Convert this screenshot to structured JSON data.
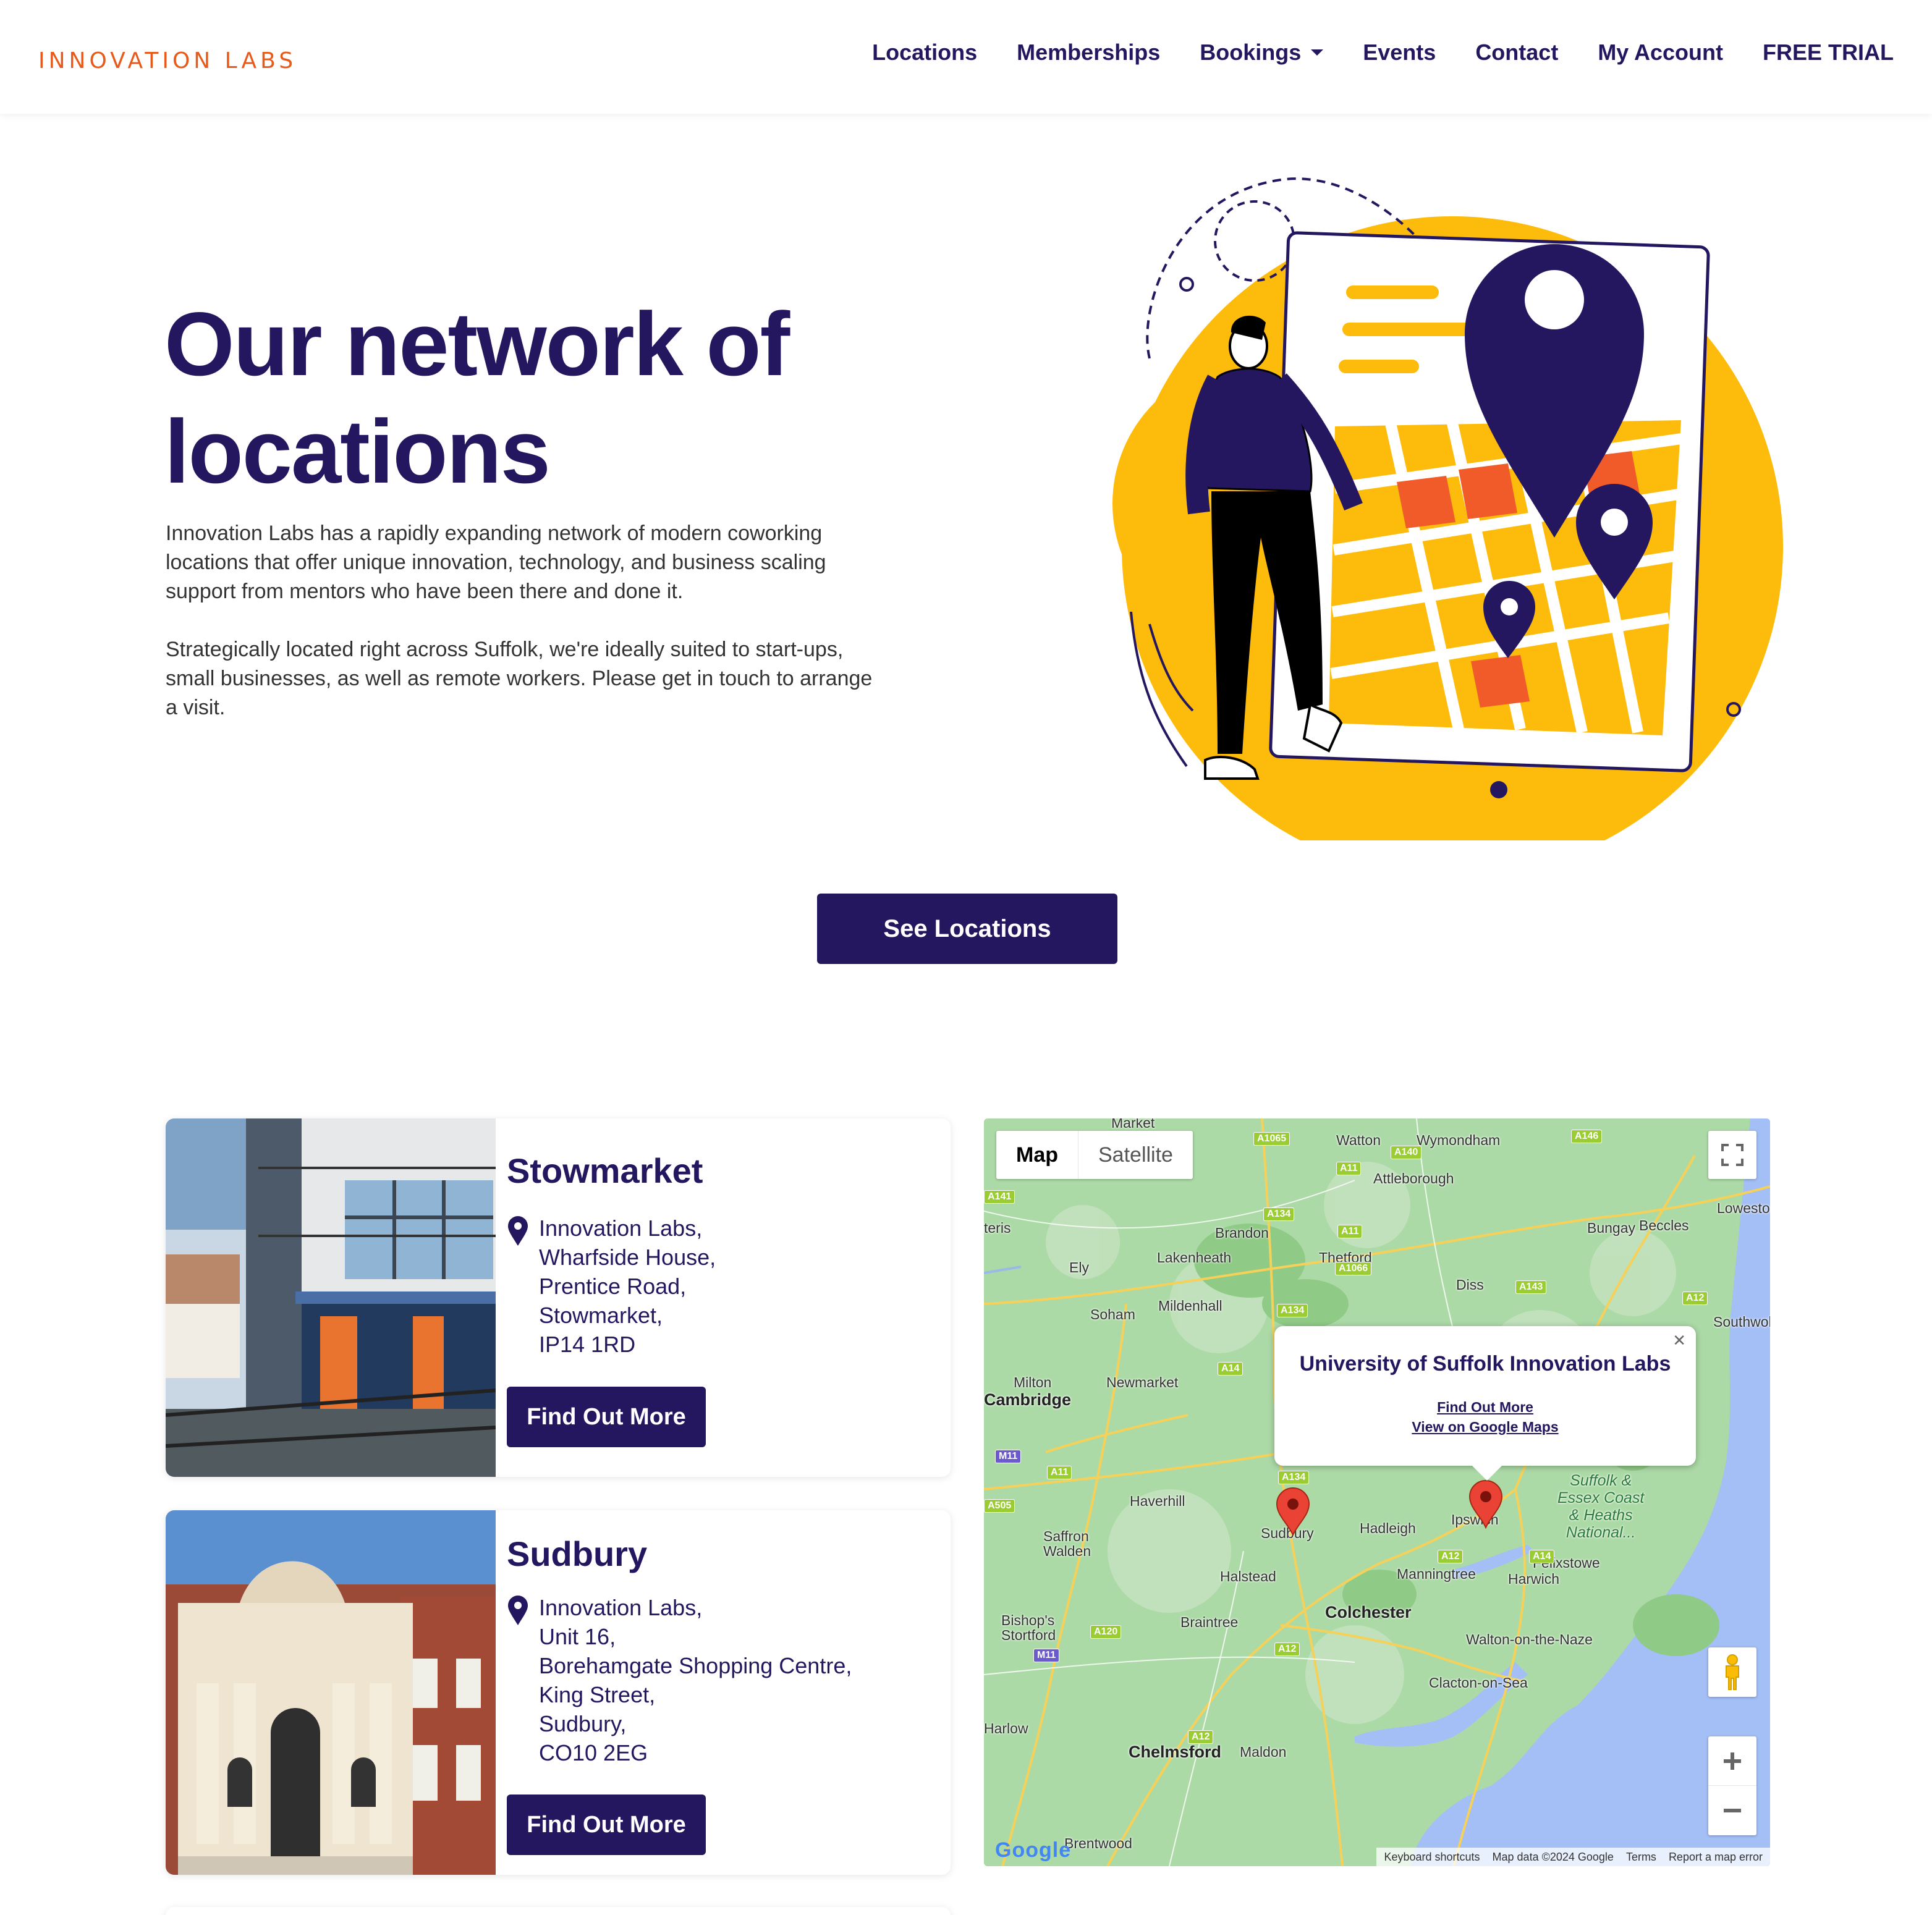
{
  "header": {
    "logo": "INNOVATION LABS",
    "nav": [
      "Locations",
      "Memberships",
      "Bookings",
      "Events",
      "Contact",
      "My Account",
      "FREE TRIAL"
    ]
  },
  "hero": {
    "title_line1": "Our network of",
    "title_line2": "locations",
    "para1": "Innovation Labs has a rapidly expanding network of modern coworking locations that offer unique innovation, technology, and business scaling support from mentors who have been there and done it.",
    "para2": "Strategically located right across Suffolk, we're ideally suited to start-ups, small businesses, as well as remote workers. Please get in touch to arrange a visit.",
    "button": "See Locations"
  },
  "locations": [
    {
      "name": "Stowmarket",
      "address": [
        "Innovation Labs,",
        "Wharfside House,",
        "Prentice Road,",
        "Stowmarket,",
        "IP14 1RD"
      ],
      "button": "Find Out More"
    },
    {
      "name": "Sudbury",
      "address": [
        "Innovation Labs,",
        "Unit 16,",
        "Borehamgate Shopping Centre,",
        "King Street,",
        "Sudbury,",
        "CO10 2EG"
      ],
      "button": "Find Out More"
    }
  ],
  "map": {
    "type_map": "Map",
    "type_satellite": "Satellite",
    "infowindow": {
      "title": "University of Suffolk Innovation Labs",
      "link1": "Find Out More",
      "link2": "View on Google Maps"
    },
    "places": {
      "market": "Market",
      "watton": "Watton",
      "wymondham": "Wymondham",
      "attleborough": "Attleborough",
      "brandon": "Brandon",
      "thetford": "Thetford",
      "bungay": "Bungay",
      "beccles": "Beccles",
      "lowestoft": "Lowesto",
      "ely": "Ely",
      "lakenheath": "Lakenheath",
      "mildenhall": "Mildenhall",
      "diss": "Diss",
      "soham": "Soham",
      "southwold": "Southwold",
      "milton": "Milton",
      "newmarket": "Newmarket",
      "cambridge": "Cambridge",
      "haverhill": "Haverhill",
      "saffron": "Saffron\nWalden",
      "sudbury": "Sudbury",
      "hadleigh": "Hadleigh",
      "ipswich": "Ipswich",
      "felixstowe": "Felixstowe",
      "harwich": "Harwich",
      "manningtree": "Manningtree",
      "halstead": "Halstead",
      "colchester": "Colchester",
      "bishops": "Bishop's\nStortford",
      "braintree": "Braintree",
      "walton": "Walton-on-the-Naze",
      "clacton": "Clacton-on-Sea",
      "harlow": "Harlow",
      "chelmsford": "Chelmsford",
      "maldon": "Maldon",
      "brentwood": "Brentwood",
      "teris": "teris",
      "park": "Suffolk &\nEssex Coast\n& Heaths\nNational..."
    },
    "footer": [
      "Keyboard shortcuts",
      "Map data ©2024 Google",
      "Terms",
      "Report a map error"
    ],
    "google": "Google"
  },
  "colors": {
    "brand": "#24175f",
    "accent": "#e85a1a",
    "yellow": "#fdbb0b",
    "orange": "#f15a29"
  },
  "icons": [
    "location-pin-icon",
    "chevron-down-icon",
    "fullscreen-icon",
    "pegman-icon",
    "zoom-in-icon",
    "zoom-out-icon",
    "close-icon",
    "map-marker-icon"
  ]
}
